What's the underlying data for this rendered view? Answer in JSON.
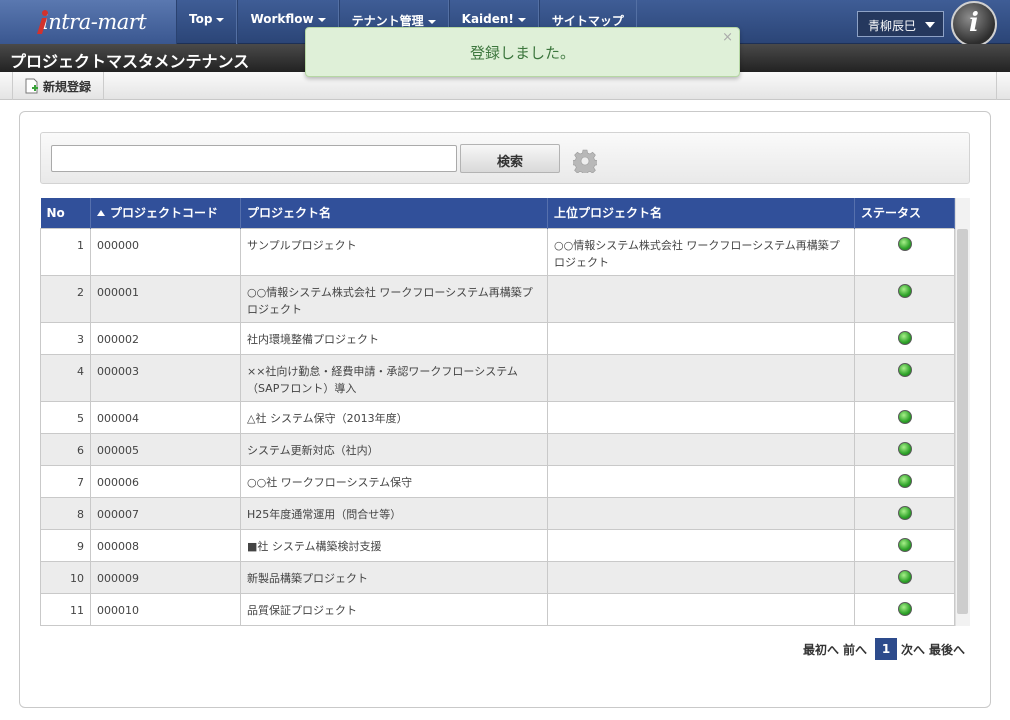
{
  "header": {
    "logo_text": "intra-mart",
    "nav": [
      {
        "label": "Top",
        "dropdown": true
      },
      {
        "label": "Workflow",
        "dropdown": true
      },
      {
        "label": "テナント管理",
        "dropdown": true
      },
      {
        "label": "Kaiden!",
        "dropdown": true
      },
      {
        "label": "サイトマップ",
        "dropdown": false
      }
    ],
    "user": "青柳辰巳",
    "info_badge": "i"
  },
  "page_title": "プロジェクトマスタメンテナンス",
  "toolbar": {
    "new_label": "新規登録"
  },
  "toast": {
    "message": "登録しました。",
    "close": "×"
  },
  "search": {
    "value": "",
    "placeholder": "",
    "button_label": "検索"
  },
  "table": {
    "columns": [
      "No",
      "プロジェクトコード",
      "プロジェクト名",
      "上位プロジェクト名",
      "ステータス"
    ],
    "sorted_column": "プロジェクトコード",
    "rows": [
      {
        "no": "1",
        "code": "000000",
        "name": "サンプルプロジェクト",
        "parent": "○○情報システム株式会社 ワークフローシステム再構築プロジェクト",
        "status": "active"
      },
      {
        "no": "2",
        "code": "000001",
        "name": "○○情報システム株式会社 ワークフローシステム再構築プロジェクト",
        "parent": "",
        "status": "active"
      },
      {
        "no": "3",
        "code": "000002",
        "name": "社内環境整備プロジェクト",
        "parent": "",
        "status": "active"
      },
      {
        "no": "4",
        "code": "000003",
        "name": "××社向け勤怠・経費申請・承認ワークフローシステム（SAPフロント）導入",
        "parent": "",
        "status": "active"
      },
      {
        "no": "5",
        "code": "000004",
        "name": "△社 システム保守（2013年度）",
        "parent": "",
        "status": "active"
      },
      {
        "no": "6",
        "code": "000005",
        "name": "システム更新対応（社内）",
        "parent": "",
        "status": "active"
      },
      {
        "no": "7",
        "code": "000006",
        "name": "○○社 ワークフローシステム保守",
        "parent": "",
        "status": "active"
      },
      {
        "no": "8",
        "code": "000007",
        "name": "H25年度通常運用（問合せ等）",
        "parent": "",
        "status": "active"
      },
      {
        "no": "9",
        "code": "000008",
        "name": "■社 システム構築検討支援",
        "parent": "",
        "status": "active"
      },
      {
        "no": "10",
        "code": "000009",
        "name": "新製品構築プロジェクト",
        "parent": "",
        "status": "active"
      },
      {
        "no": "11",
        "code": "000010",
        "name": "品質保証プロジェクト",
        "parent": "",
        "status": "active"
      }
    ]
  },
  "pager": {
    "first": "最初へ",
    "prev": "前へ",
    "current": "1",
    "next": "次へ",
    "last": "最後へ"
  },
  "colors": {
    "nav": "#2b4577",
    "header_row": "#31509a",
    "toast_bg": "#dff0d8",
    "status_ok": "#2fa32a",
    "page_current": "#2d4b8c"
  }
}
